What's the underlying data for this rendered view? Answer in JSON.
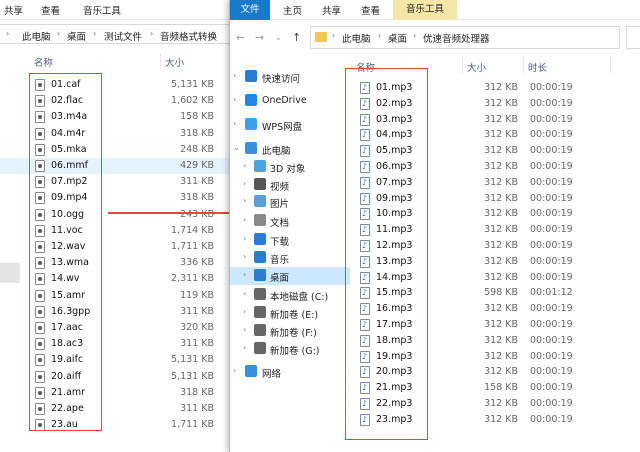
{
  "back_window": {
    "ribbon_tabs": [
      "共享",
      "查看",
      "音乐工具"
    ],
    "breadcrumb": [
      "此电脑",
      "桌面",
      "测试文件",
      "音频格式转换"
    ],
    "columns": {
      "name": "名称",
      "size": "大小"
    },
    "files": [
      {
        "name": "01.caf",
        "size": "5,131 KB"
      },
      {
        "name": "02.flac",
        "size": "1,602 KB"
      },
      {
        "name": "03.m4a",
        "size": "158 KB"
      },
      {
        "name": "04.m4r",
        "size": "318 KB"
      },
      {
        "name": "05.mka",
        "size": "248 KB"
      },
      {
        "name": "06.mmf",
        "size": "429 KB"
      },
      {
        "name": "07.mp2",
        "size": "311 KB"
      },
      {
        "name": "09.mp4",
        "size": "318 KB"
      },
      {
        "name": "10.ogg",
        "size": "243 KB"
      },
      {
        "name": "11.voc",
        "size": "1,714 KB"
      },
      {
        "name": "12.wav",
        "size": "1,711 KB"
      },
      {
        "name": "13.wma",
        "size": "336 KB"
      },
      {
        "name": "14.wv",
        "size": "2,311 KB"
      },
      {
        "name": "15.amr",
        "size": "119 KB"
      },
      {
        "name": "16.3gpp",
        "size": "311 KB"
      },
      {
        "name": "17.aac",
        "size": "320 KB"
      },
      {
        "name": "18.ac3",
        "size": "311 KB"
      },
      {
        "name": "19.aifc",
        "size": "5,131 KB"
      },
      {
        "name": "20.aiff",
        "size": "5,131 KB"
      },
      {
        "name": "21.amr",
        "size": "318 KB"
      },
      {
        "name": "22.ape",
        "size": "311 KB"
      },
      {
        "name": "23.au",
        "size": "1,711 KB"
      }
    ],
    "highlighted_index": 5
  },
  "front_window": {
    "ribbon_tabs": {
      "file": "文件",
      "home": "主页",
      "share": "共享",
      "view": "查看",
      "music": "音乐工具"
    },
    "breadcrumb": [
      "此电脑",
      "桌面",
      "优速音频处理器"
    ],
    "columns": {
      "name": "名称",
      "size": "大小",
      "duration": "时长"
    },
    "nav": [
      {
        "label": "快速访问",
        "icon": "star-icon",
        "color": "#2b7cd3",
        "indent": 0,
        "expander": "›"
      },
      {
        "label": "OneDrive",
        "icon": "cloud-icon",
        "color": "#1e88e5",
        "indent": 0,
        "expander": "›"
      },
      {
        "label": "WPS网盘",
        "icon": "cloud-icon",
        "color": "#3aa0e8",
        "indent": 0,
        "expander": "›"
      },
      {
        "label": "此电脑",
        "icon": "computer-icon",
        "color": "#3b8ed8",
        "indent": 0,
        "expander": "⌄"
      },
      {
        "label": "3D 对象",
        "icon": "cube-icon",
        "color": "#4aa3df",
        "indent": 1,
        "expander": "›"
      },
      {
        "label": "视频",
        "icon": "video-icon",
        "color": "#555555",
        "indent": 1,
        "expander": "›"
      },
      {
        "label": "图片",
        "icon": "picture-icon",
        "color": "#5aa0d6",
        "indent": 1,
        "expander": "›"
      },
      {
        "label": "文档",
        "icon": "document-icon",
        "color": "#8a8a8a",
        "indent": 1,
        "expander": "›"
      },
      {
        "label": "下载",
        "icon": "download-icon",
        "color": "#2b7cd3",
        "indent": 1,
        "expander": "›"
      },
      {
        "label": "音乐",
        "icon": "music-icon",
        "color": "#2b7cd3",
        "indent": 1,
        "expander": "›"
      },
      {
        "label": "桌面",
        "icon": "desktop-icon",
        "color": "#2b7cd3",
        "indent": 1,
        "expander": "›",
        "selected": true
      },
      {
        "label": "本地磁盘 (C:)",
        "icon": "drive-icon",
        "color": "#666666",
        "indent": 1,
        "expander": "›"
      },
      {
        "label": "新加卷 (E:)",
        "icon": "drive-icon",
        "color": "#666666",
        "indent": 1,
        "expander": "›"
      },
      {
        "label": "新加卷 (F:)",
        "icon": "drive-icon",
        "color": "#666666",
        "indent": 1,
        "expander": "›"
      },
      {
        "label": "新加卷 (G:)",
        "icon": "drive-icon",
        "color": "#666666",
        "indent": 1,
        "expander": "›"
      },
      {
        "label": "网络",
        "icon": "network-icon",
        "color": "#3b8ed8",
        "indent": 0,
        "expander": "›"
      }
    ],
    "files": [
      {
        "name": "01.mp3",
        "size": "312 KB",
        "duration": "00:00:19"
      },
      {
        "name": "02.mp3",
        "size": "312 KB",
        "duration": "00:00:19"
      },
      {
        "name": "03.mp3",
        "size": "312 KB",
        "duration": "00:00:19"
      },
      {
        "name": "04.mp3",
        "size": "312 KB",
        "duration": "00:00:19"
      },
      {
        "name": "05.mp3",
        "size": "312 KB",
        "duration": "00:00:19"
      },
      {
        "name": "06.mp3",
        "size": "312 KB",
        "duration": "00:00:19"
      },
      {
        "name": "07.mp3",
        "size": "312 KB",
        "duration": "00:00:19"
      },
      {
        "name": "09.mp3",
        "size": "312 KB",
        "duration": "00:00:19"
      },
      {
        "name": "10.mp3",
        "size": "312 KB",
        "duration": "00:00:19"
      },
      {
        "name": "11.mp3",
        "size": "312 KB",
        "duration": "00:00:19"
      },
      {
        "name": "12.mp3",
        "size": "312 KB",
        "duration": "00:00:19"
      },
      {
        "name": "13.mp3",
        "size": "312 KB",
        "duration": "00:00:19"
      },
      {
        "name": "14.mp3",
        "size": "312 KB",
        "duration": "00:00:19"
      },
      {
        "name": "15.mp3",
        "size": "598 KB",
        "duration": "00:01:12"
      },
      {
        "name": "16.mp3",
        "size": "312 KB",
        "duration": "00:00:19"
      },
      {
        "name": "17.mp3",
        "size": "312 KB",
        "duration": "00:00:19"
      },
      {
        "name": "18.mp3",
        "size": "312 KB",
        "duration": "00:00:19"
      },
      {
        "name": "19.mp3",
        "size": "312 KB",
        "duration": "00:00:19"
      },
      {
        "name": "20.mp3",
        "size": "312 KB",
        "duration": "00:00:19"
      },
      {
        "name": "21.mp3",
        "size": "158 KB",
        "duration": "00:00:19"
      },
      {
        "name": "22.mp3",
        "size": "312 KB",
        "duration": "00:00:19"
      },
      {
        "name": "23.mp3",
        "size": "312 KB",
        "duration": "00:00:19"
      }
    ]
  },
  "colors": {
    "accent": "#1979ca",
    "highlight_box": "#e8453c",
    "selection": "#cce8ff",
    "music_tab": "#f5e6a8"
  }
}
